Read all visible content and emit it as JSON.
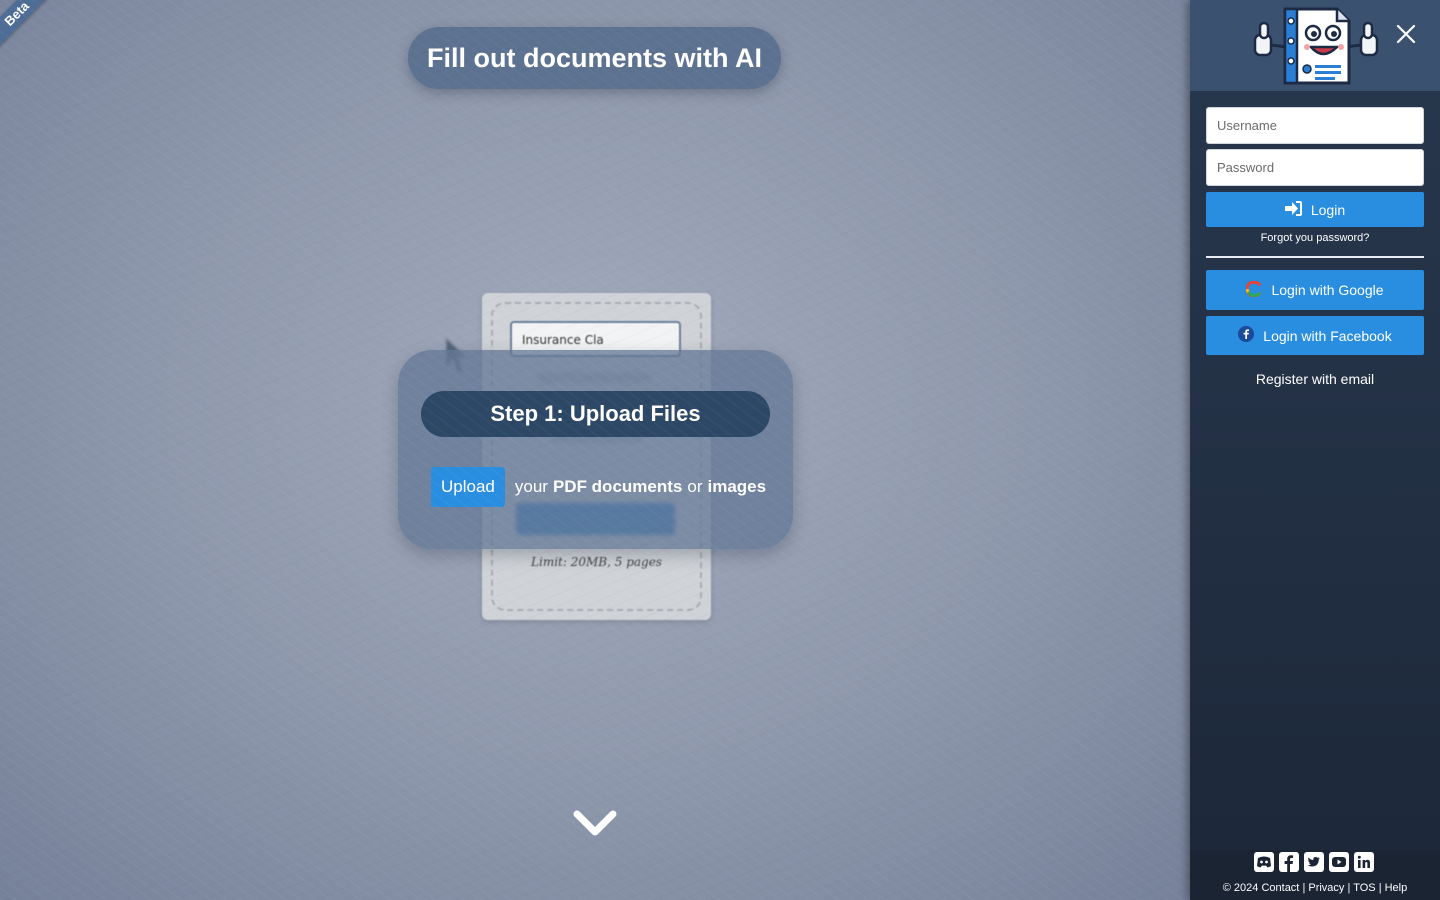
{
  "beta": "Beta",
  "headline": "Fill out documents with AI",
  "demo": {
    "field_value": "Insurance Cla",
    "limit": "Limit: 20MB, 5 pages"
  },
  "step": {
    "title": "Step 1: Upload Files",
    "upload_button": "Upload",
    "text_your": "your",
    "text_pdf": "PDF documents",
    "text_or": "or",
    "text_images": "images"
  },
  "sidebar": {
    "username_placeholder": "Username",
    "password_placeholder": "Password",
    "login_label": "Login",
    "forgot_label": "Forgot you password?",
    "google_label": "Login with Google",
    "facebook_label": "Login with Facebook",
    "register_label": "Register with email"
  },
  "footer": {
    "copyright": "© 2024",
    "contact": "Contact",
    "privacy": "Privacy",
    "tos": "TOS",
    "help": "Help",
    "separator": "|",
    "social_icons": [
      "discord-icon",
      "facebook-icon",
      "twitter-icon",
      "youtube-icon",
      "linkedin-icon"
    ]
  },
  "colors": {
    "accent": "#2a8ee0",
    "sidebar": "#27374d",
    "step_title": "#2d4866"
  }
}
